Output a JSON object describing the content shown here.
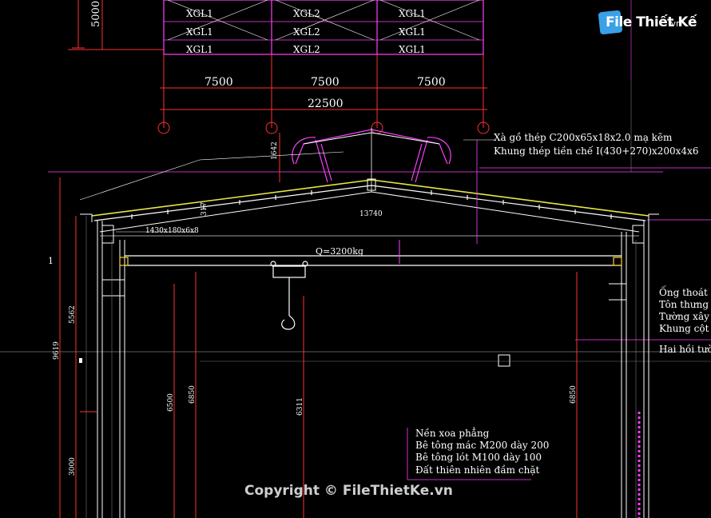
{
  "top_plan": {
    "height_dim": "5000",
    "bracing_labels": [
      [
        "XGL1",
        "XGL2",
        "XGL1"
      ],
      [
        "XGL1",
        "XGL2",
        "XGL1"
      ],
      [
        "XGL1",
        "XGL2",
        "XGL1"
      ]
    ],
    "bay_dims": [
      "7500",
      "7500",
      "7500"
    ],
    "total_dim": "22500"
  },
  "section": {
    "purlin_note": "Xà gồ thép C200x65x18x2.0 mạ kẽm",
    "frame_note": "Khung thép tiền chế I(430+270)x200x4x6",
    "span_dim": "13740",
    "ridge_dim": "1642",
    "haunch_dim": "1430x180x6x8",
    "slope_dim": "317",
    "crane_load": "Q=3200kg",
    "left_label": "1",
    "col_height_total": "9619",
    "col_height_upper": "5562",
    "col_height_lower": "3000",
    "crane_rail_left": "6850",
    "crane_rail_right": "6850",
    "crane_beam_left": "6500",
    "hook_height": "6311",
    "right_notes": [
      "Ống thoát nư",
      "Tôn thưng d",
      "Tường xây g",
      "Khung cột th",
      "Hai hồi tườn"
    ],
    "floor_notes": [
      "Nền xoa phẳng",
      "Bê tông mác M200 dày 200",
      "Bê tông lót M100 dày 100",
      "Đất thiên nhiên đầm chặt"
    ]
  },
  "watermark": {
    "logo_text": "File Thiết Kế",
    "logo_suffix": ".vn",
    "copyright": "Copyright © FileThietKe.vn"
  },
  "colors": {
    "background": "#000000",
    "lines": "#ffffff",
    "dimension": "#ff3030",
    "construction": "#ff40ff",
    "logo_blue": "#3aa0e8"
  }
}
